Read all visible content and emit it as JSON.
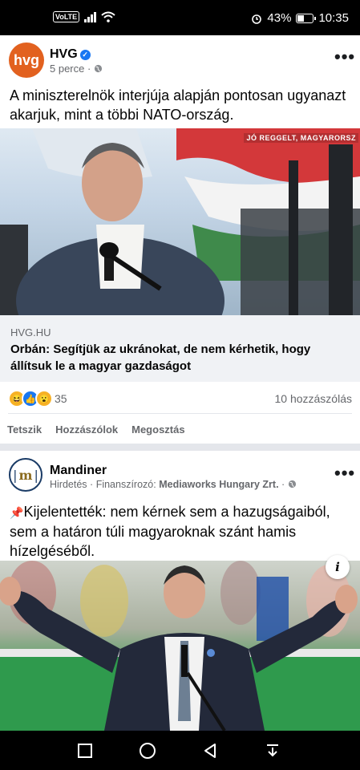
{
  "status": {
    "network": "VoLTE",
    "battery": "43%",
    "battery_level": 0.43,
    "time": "10:35"
  },
  "post1": {
    "page_name": "HVG",
    "avatar_text": "hvg",
    "time": "5 perce",
    "separator": "·",
    "text": "A miniszterelnök interjúja alapján pontosan ugyanazt akarjuk, mint a többi NATO-ország.",
    "image_caption": "JÓ REGGELT, MAGYARORSZ",
    "link_source": "HVG.HU",
    "link_title": "Orbán: Segítjük az ukránokat, de nem kérhetik, hogy állítsuk le a magyar gazdaságot",
    "reaction_count": "35",
    "comment_count": "10 hozzászólás",
    "actions": {
      "like": "Tetszik",
      "comment": "Hozzászólok",
      "share": "Megosztás"
    }
  },
  "post2": {
    "page_name": "Mandiner",
    "avatar_text": "m",
    "sponsored": "Hirdetés",
    "separator": "·",
    "funder_label": "Finanszírozó:",
    "funder_name": "Mediaworks Hungary Zrt.",
    "separator2": "·",
    "pin": "📌",
    "text": "Kijelentették: nem kérnek sem a hazugságaiból, sem a határon túli magyaroknak szánt hamis hízelgéséből.",
    "info": "i"
  },
  "colors": {
    "hvg_orange": "#e2611f",
    "facebook_blue": "#1877f2",
    "muted_text": "#65676b",
    "separator": "#e4e6eb"
  }
}
